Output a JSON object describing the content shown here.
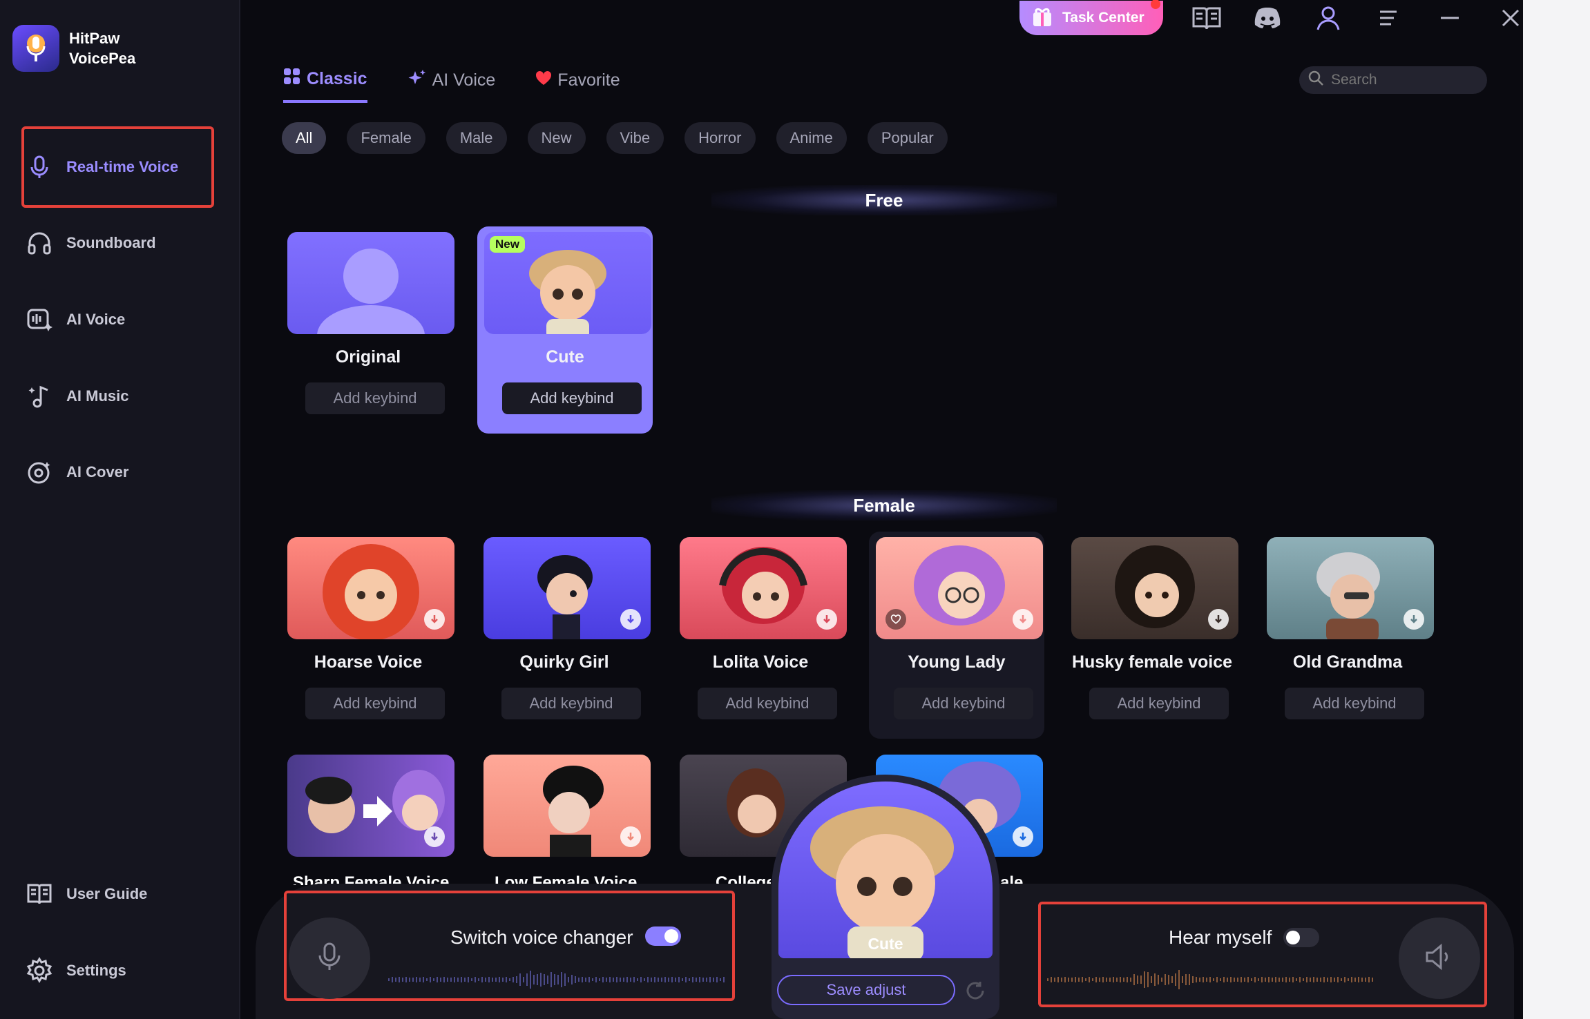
{
  "app": {
    "brand_line1": "HitPaw",
    "brand_line2": "VoicePea"
  },
  "sidebar": {
    "items": [
      {
        "label": "Real-time Voice",
        "icon": "microphone-icon",
        "active": true
      },
      {
        "label": "Soundboard",
        "icon": "headphones-icon"
      },
      {
        "label": "AI Voice",
        "icon": "ai-voice-icon"
      },
      {
        "label": "AI Music",
        "icon": "ai-music-icon"
      },
      {
        "label": "AI Cover",
        "icon": "ai-cover-icon"
      }
    ],
    "bottom": [
      {
        "label": "User Guide",
        "icon": "book-icon"
      },
      {
        "label": "Settings",
        "icon": "gear-icon"
      }
    ]
  },
  "topbar": {
    "task_center": "Task Center",
    "icons": [
      "guide-book-icon",
      "discord-icon",
      "user-icon",
      "menu-icon",
      "minimize-icon",
      "close-icon"
    ]
  },
  "tabs": [
    {
      "label": "Classic",
      "icon": "grid-icon",
      "active": true
    },
    {
      "label": "AI Voice",
      "icon": "sparkle-icon"
    },
    {
      "label": "Favorite",
      "icon": "heart-icon"
    }
  ],
  "search": {
    "placeholder": "Search"
  },
  "chips": [
    "All",
    "Female",
    "Male",
    "New",
    "Vibe",
    "Horror",
    "Anime",
    "Popular"
  ],
  "sections": {
    "free": {
      "title": "Free",
      "cards": [
        {
          "name": "Original",
          "keybind": "Add keybind"
        },
        {
          "name": "Cute",
          "keybind": "Add keybind",
          "badge": "New",
          "selected": true
        }
      ]
    },
    "female": {
      "title": "Female",
      "cards": [
        {
          "name": "Hoarse Voice",
          "keybind": "Add keybind"
        },
        {
          "name": "Quirky Girl",
          "keybind": "Add keybind"
        },
        {
          "name": "Lolita Voice",
          "keybind": "Add keybind"
        },
        {
          "name": "Young Lady",
          "keybind": "Add keybind"
        },
        {
          "name": "Husky female voice",
          "keybind": "Add keybind"
        },
        {
          "name": "Old Grandma",
          "keybind": "Add keybind"
        }
      ],
      "partial_row": [
        "Sharp Female Voice",
        "Low Female Voice",
        "College",
        "ale"
      ]
    }
  },
  "controls": {
    "switch_label": "Switch voice changer",
    "switch_on": true,
    "hear_label": "Hear myself",
    "hear_on": false,
    "current_voice": "Cute",
    "save_adjust": "Save adjust"
  },
  "colors": {
    "accent": "#8b7fff",
    "highlight": "#e5413a",
    "background": "#0a0a10",
    "sidebar": "#15151f"
  }
}
